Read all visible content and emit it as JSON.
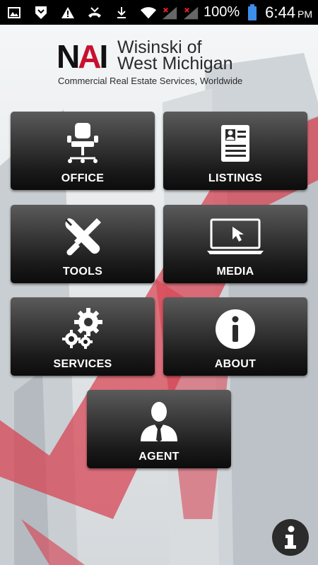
{
  "status_bar": {
    "battery": "100%",
    "time": "6:44",
    "ampm": "PM"
  },
  "logo": {
    "mark_left": "N",
    "mark_mid": "A",
    "mark_right": "I",
    "name_line1": "Wisinski of",
    "name_line2": "West Michigan",
    "tagline": "Commercial Real Estate Services, Worldwide"
  },
  "menu": {
    "office": "OFFICE",
    "listings": "LISTINGS",
    "tools": "TOOLS",
    "media": "MEDIA",
    "services": "SERVICES",
    "about": "ABOUT",
    "agent": "AGENT"
  },
  "colors": {
    "brand_red": "#c8102e",
    "tile_dark": "#1a1a1a"
  },
  "icons": {
    "office": "office-chair-icon",
    "listings": "document-profile-icon",
    "tools": "wrench-screwdriver-icon",
    "media": "laptop-cursor-icon",
    "services": "gears-icon",
    "about": "info-circle-icon",
    "agent": "businessman-icon",
    "fab": "info-icon"
  }
}
